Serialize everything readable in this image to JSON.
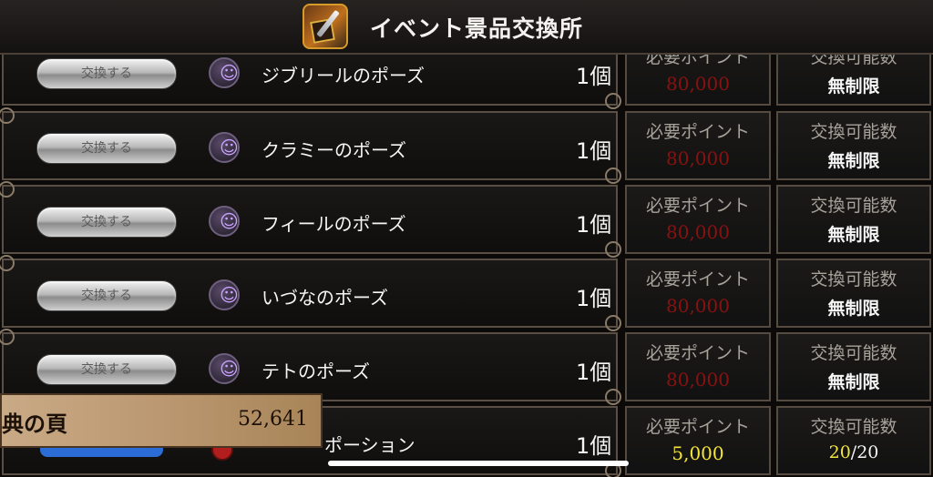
{
  "header": {
    "title": "イベント景品交換所",
    "icon": "event-shop-icon"
  },
  "labels": {
    "exchange_button": "交換する",
    "points_label": "必要ポイント",
    "count_label": "交換可能数"
  },
  "items": [
    {
      "name": "ジブリールのポーズ",
      "qty": "1個",
      "points": "80,000",
      "limit": "無制限"
    },
    {
      "name": "クラミーのポーズ",
      "qty": "1個",
      "points": "80,000",
      "limit": "無制限"
    },
    {
      "name": "フィールのポーズ",
      "qty": "1個",
      "points": "80,000",
      "limit": "無制限"
    },
    {
      "name": "いづなのポーズ",
      "qty": "1個",
      "points": "80,000",
      "limit": "無制限"
    },
    {
      "name": "テトのポーズ",
      "qty": "1個",
      "points": "80,000",
      "limit": "無制限"
    },
    {
      "name": "ポーション",
      "qty": "1個",
      "points": "5,000",
      "limit_current": "20",
      "limit_sep": "/",
      "limit_total": "20"
    }
  ],
  "points_panel": {
    "label": "典の頁",
    "value": "52,641"
  },
  "colors": {
    "points_red": "#8a1111",
    "points_yellow": "#f4e53a",
    "panel_bg": "#b8946c"
  }
}
